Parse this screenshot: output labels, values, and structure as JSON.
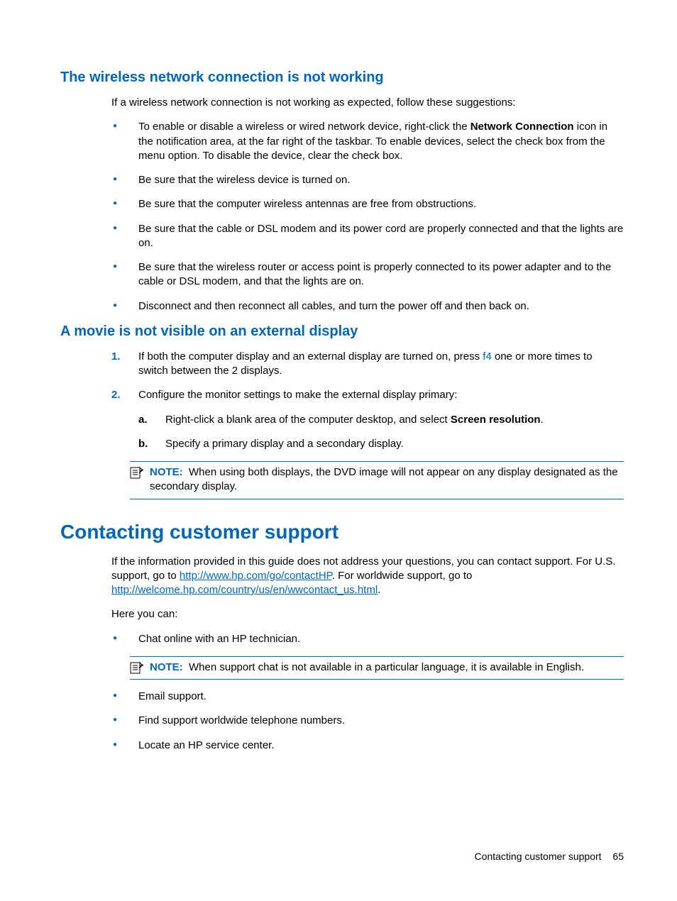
{
  "section1": {
    "heading": "The wireless network connection is not working",
    "intro": "If a wireless network connection is not working as expected, follow these suggestions:",
    "bullet1_a": "To enable or disable a wireless or wired network device, right-click the ",
    "bullet1_bold": "Network Connection",
    "bullet1_b": " icon in the notification area, at the far right of the taskbar. To enable devices, select the check box from the menu option. To disable the device, clear the check box.",
    "bullet2": "Be sure that the wireless device is turned on.",
    "bullet3": "Be sure that the computer wireless antennas are free from obstructions.",
    "bullet4": "Be sure that the cable or DSL modem and its power cord are properly connected and that the lights are on.",
    "bullet5": "Be sure that the wireless router or access point is properly connected to its power adapter and to the cable or DSL modem, and that the lights are on.",
    "bullet6": "Disconnect and then reconnect all cables, and turn the power off and then back on."
  },
  "section2": {
    "heading": "A movie is not visible on an external display",
    "item1_a": "If both the computer display and an external display are turned on, press ",
    "item1_key": "f4",
    "item1_b": " one or more times to switch between the 2 displays.",
    "item2": "Configure the monitor settings to make the external display primary:",
    "item2a_a": "Right-click a blank area of the computer desktop, and select ",
    "item2a_bold": "Screen resolution",
    "item2a_b": ".",
    "item2b": "Specify a primary display and a secondary display.",
    "note_label": "NOTE:",
    "note_text": "When using both displays, the DVD image will not appear on any display designated as the secondary display."
  },
  "section3": {
    "heading": "Contacting customer support",
    "p1_a": "If the information provided in this guide does not address your questions, you can contact support. For U.S. support, go to ",
    "p1_link1": "http://www.hp.com/go/contactHP",
    "p1_b": ". For worldwide support, go to ",
    "p1_link2": "http://welcome.hp.com/country/us/en/wwcontact_us.html",
    "p1_c": ".",
    "p2": "Here you can:",
    "bullet1": "Chat online with an HP technician.",
    "note_label": "NOTE:",
    "note_text": "When support chat is not available in a particular language, it is available in English.",
    "bullet2": "Email support.",
    "bullet3": "Find support worldwide telephone numbers.",
    "bullet4": "Locate an HP service center."
  },
  "footer": {
    "text": "Contacting customer support",
    "page": "65"
  }
}
